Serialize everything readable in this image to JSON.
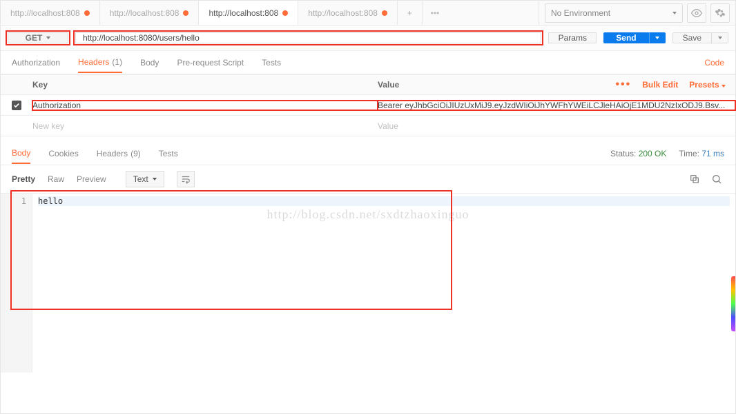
{
  "env": {
    "selected": "No Environment"
  },
  "tabs": [
    {
      "label": "http://localhost:808",
      "dirty": true,
      "active": false
    },
    {
      "label": "http://localhost:808",
      "dirty": true,
      "active": false
    },
    {
      "label": "http://localhost:808",
      "dirty": true,
      "active": true
    },
    {
      "label": "http://localhost:808",
      "dirty": true,
      "active": false
    }
  ],
  "tab_add": "+",
  "tab_more": "•••",
  "request": {
    "method": "GET",
    "url": "http://localhost:8080/users/hello",
    "params_label": "Params",
    "send_label": "Send",
    "save_label": "Save"
  },
  "req_tabs": {
    "authorization": "Authorization",
    "headers": "Headers",
    "headers_count": "(1)",
    "body": "Body",
    "prescript": "Pre-request Script",
    "tests": "Tests",
    "code": "Code"
  },
  "headers_table": {
    "key_header": "Key",
    "value_header": "Value",
    "more": "•••",
    "bulk": "Bulk Edit",
    "presets": "Presets",
    "rows": [
      {
        "key": "Authorization",
        "value": "Bearer eyJhbGciOiJIUzUxMiJ9.eyJzdWIiOiJhYWFhYWEiLCJleHAiOjE1MDU2NzIxODJ9.Bsv..."
      }
    ],
    "new_key_ph": "New key",
    "new_val_ph": "Value"
  },
  "resp_tabs": {
    "body": "Body",
    "cookies": "Cookies",
    "headers": "Headers",
    "headers_count": "(9)",
    "tests": "Tests",
    "status_label": "Status:",
    "status_value": "200 OK",
    "time_label": "Time:",
    "time_value": "71 ms"
  },
  "body_toolbar": {
    "pretty": "Pretty",
    "raw": "Raw",
    "preview": "Preview",
    "type": "Text"
  },
  "response": {
    "line_no": "1",
    "content": "hello"
  },
  "watermark": "http://blog.csdn.net/sxdtzhaoxinguo"
}
